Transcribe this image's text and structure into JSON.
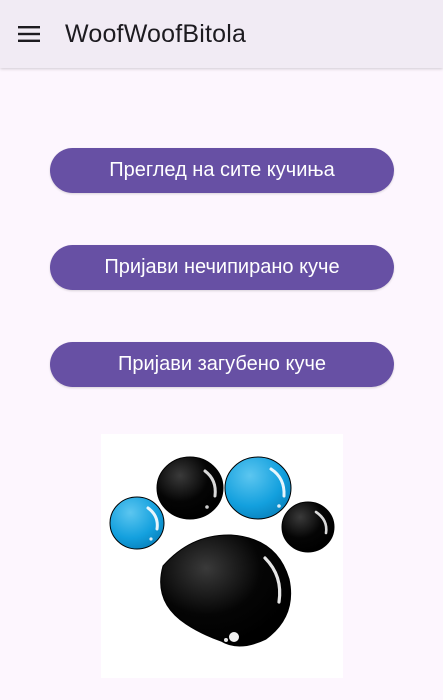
{
  "app_bar": {
    "title": "WoofWoofBitola",
    "menu_icon": "hamburger-menu-icon",
    "background": "#f1ebf4"
  },
  "buttons": {
    "view_all": "Преглед на сите кучиња",
    "report_unchipped": "Пријави нечипирано куче",
    "report_lost": "Пријави загубено куче"
  },
  "theme": {
    "primary": "#6750a4",
    "background": "#fdf6fe",
    "paw_black": "#000000",
    "paw_blue": "#1ca0de"
  },
  "logo": {
    "icon": "paw-print-logo"
  }
}
